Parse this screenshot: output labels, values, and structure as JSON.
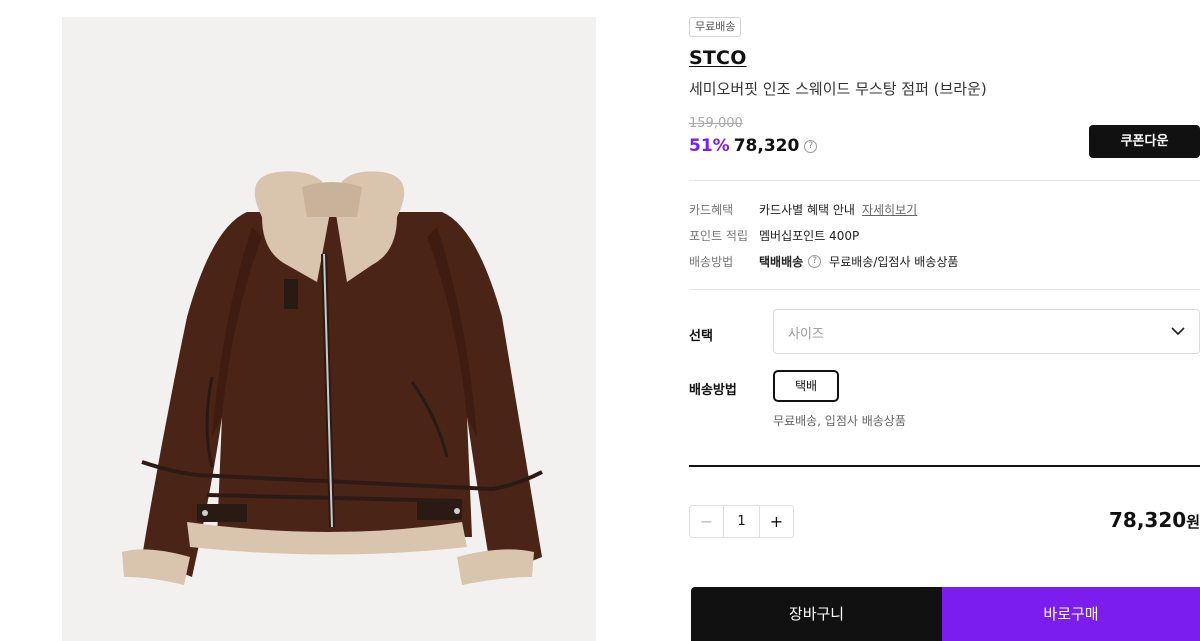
{
  "product": {
    "badge": "무료배송",
    "brand": "STCO",
    "name": "세미오버핏 인조 스웨이드 무스탕 점퍼 (브라운)",
    "original_price": "159,000",
    "discount": "51%",
    "sale_price": "78,320",
    "coupon_label": "쿠폰다운"
  },
  "benefits": {
    "card_label": "카드혜택",
    "card_value": "카드사별 혜택 안내",
    "card_link": "자세히보기",
    "point_label": "포인트 적립",
    "point_value": "멤버십포인트 400P",
    "ship_label": "배송방법",
    "ship_method": "택배배송",
    "ship_desc": "무료배송/입점사 배송상품"
  },
  "options": {
    "select_label": "선택",
    "size_placeholder": "사이즈",
    "shipping_label": "배송방법",
    "shipping_option": "택배",
    "shipping_note": "무료배송, 입점사 배송상품"
  },
  "order": {
    "quantity": "1",
    "total": "78,320",
    "currency": "원",
    "cart_label": "장바구니",
    "buy_label": "바로구매"
  },
  "colors": {
    "accent": "#7c1df0",
    "dark": "#111111",
    "jacket": "#4a2417",
    "shearling": "#d9c4ad"
  },
  "icons": [
    "help-circle-icon",
    "chevron-down-icon",
    "minus-icon",
    "plus-icon"
  ]
}
